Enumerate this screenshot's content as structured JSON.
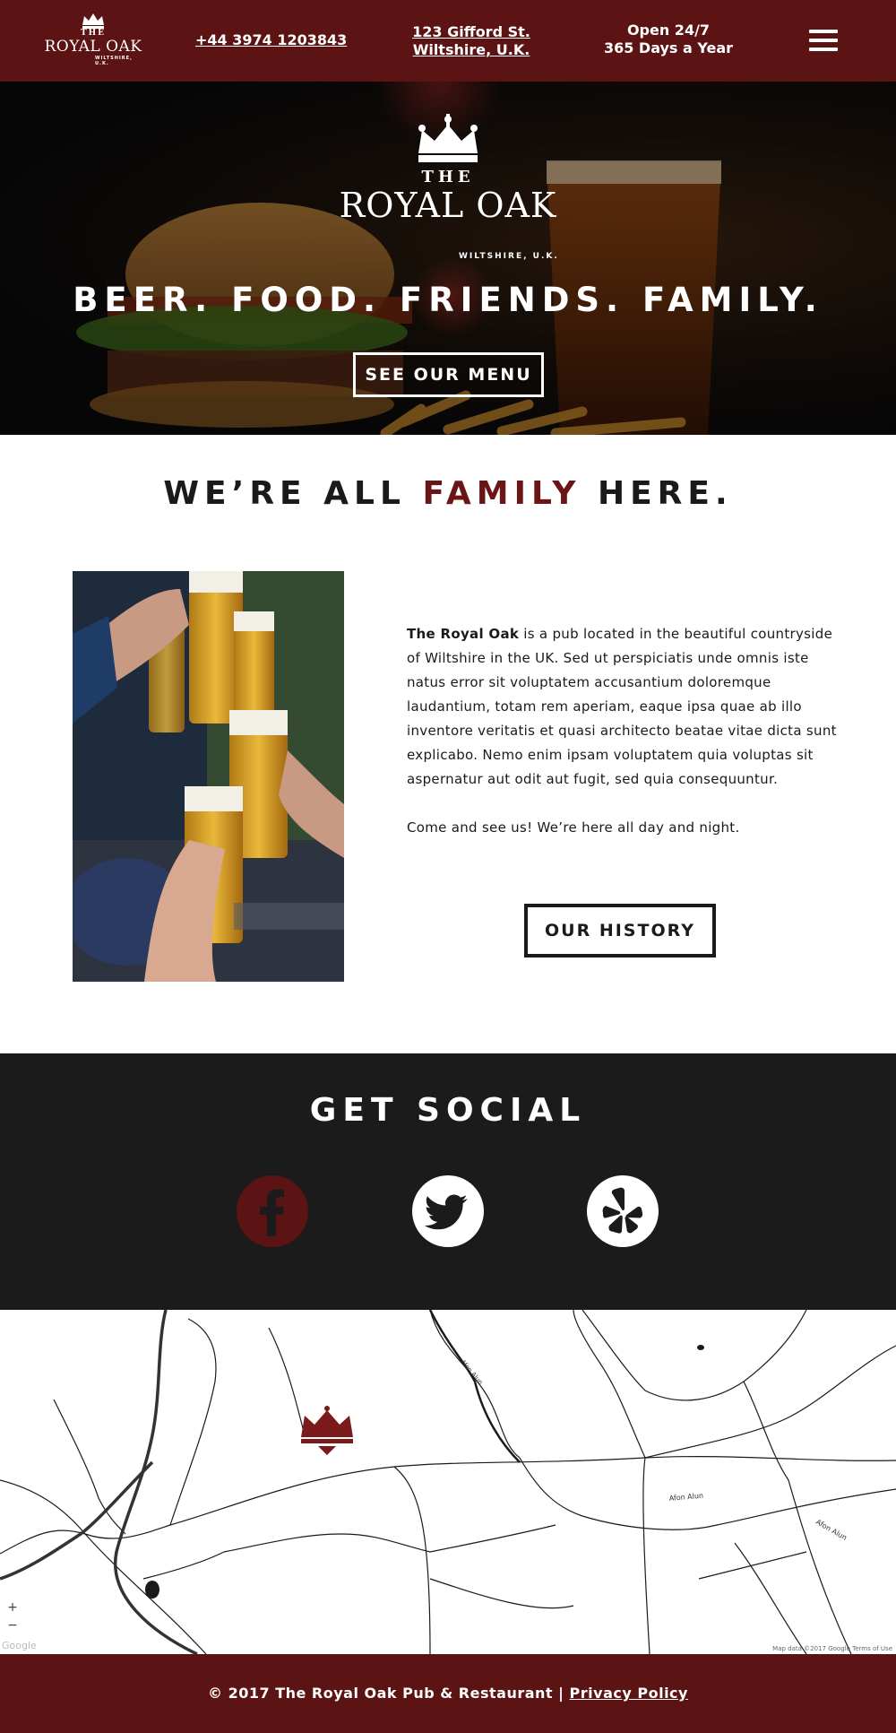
{
  "header": {
    "logo": {
      "the": "THE",
      "name": "ROYAL OAK",
      "location": "WILTSHIRE, U.K."
    },
    "phone": "+44 3974 1203843",
    "address_line1": "123 Gifford St.",
    "address_line2": "Wiltshire, U.K.",
    "hours_line1": "Open 24/7",
    "hours_line2": "365 Days a Year",
    "menu_icon": "hamburger-menu-icon"
  },
  "hero": {
    "logo": {
      "the": "THE",
      "name": "ROYAL OAK",
      "location": "WILTSHIRE, U.K."
    },
    "tagline": "BEER. FOOD. FRIENDS. FAMILY.",
    "menu_button": "SEE OUR MENU"
  },
  "family": {
    "title_part1": "WE’RE ALL ",
    "title_accent": "FAMILY",
    "title_part2": " HERE.",
    "paragraph1_bold": "The Royal Oak",
    "paragraph1_rest": " is a pub located in the beautiful countryside of Wiltshire in the UK. Sed ut perspiciatis unde omnis iste natus error sit voluptatem accusantium doloremque laudantium, totam rem aperiam, eaque ipsa quae ab illo inventore veritatis et quasi architecto beatae vitae dicta sunt explicabo. Nemo enim ipsam voluptatem quia voluptas sit aspernatur aut odit aut fugit, sed quia consequuntur.",
    "paragraph2": "Come and see us! We’re here all day and night.",
    "history_button": "OUR HISTORY"
  },
  "social": {
    "title": "GET SOCIAL",
    "icons": [
      "facebook-icon",
      "twitter-icon",
      "yelp-icon"
    ]
  },
  "map": {
    "zoom_in": "+",
    "zoom_out": "−",
    "road_labels": [
      "Afon Alun",
      "Afon Alun",
      "Afon Alun"
    ],
    "google": "Google",
    "terms": "Map data ©2017 Google    Terms of Use",
    "marker_icon": "crown-marker-icon"
  },
  "footer": {
    "copyright": "© 2017 The Royal Oak Pub & Restaurant | ",
    "privacy": "Privacy Policy"
  },
  "colors": {
    "brand_red": "#5c1313",
    "accent_red": "#6b1616",
    "dark": "#1b1b1b"
  }
}
